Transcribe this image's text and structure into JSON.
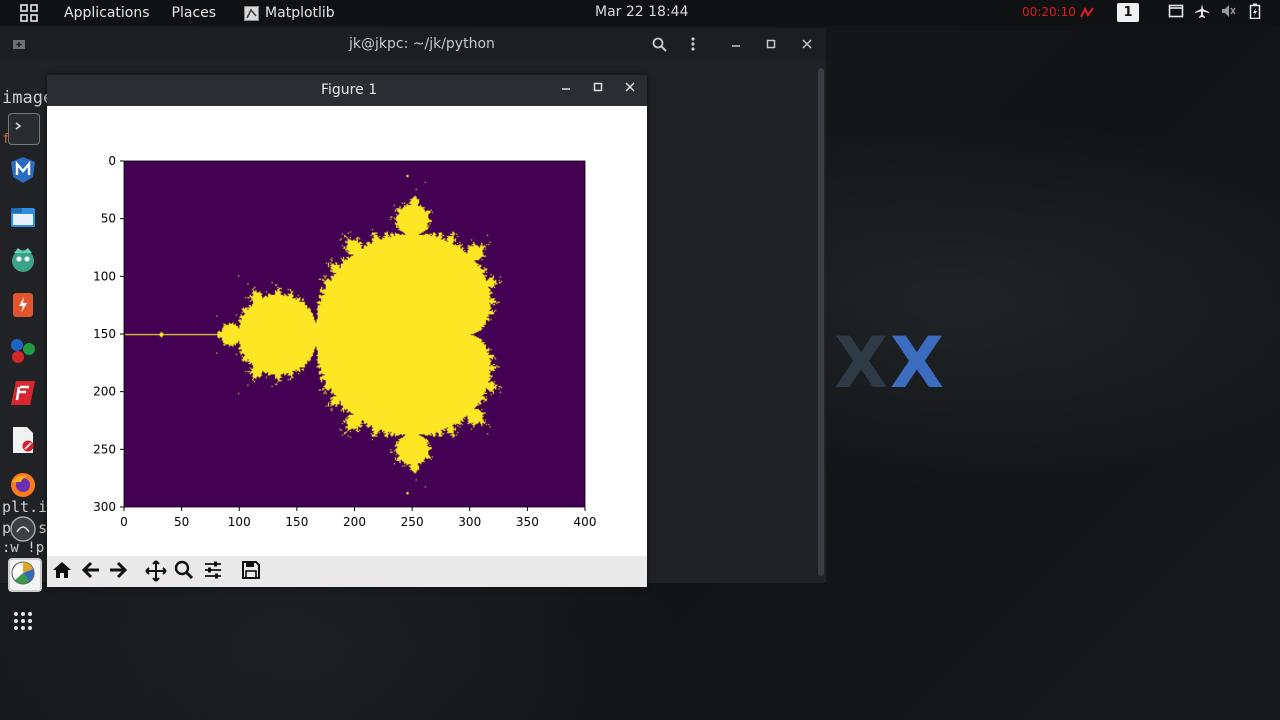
{
  "panel": {
    "menu_applications": "Applications",
    "menu_places": "Places",
    "active_app": "Matplotlib",
    "clock": "Mar 22  18:44",
    "timer": "00:20:10",
    "workspace": "1"
  },
  "terminal": {
    "title": "jk@jkpc: ~/jk/python",
    "lines": [
      "image",
      "fo",
      "plt.i",
      "plt.s",
      ":w !p"
    ]
  },
  "desktop": {
    "watermark": "LINUX",
    "watermark_x": "X"
  },
  "figure": {
    "title": "Figure 1",
    "toolbar": [
      "home-icon",
      "back-icon",
      "forward-icon",
      "pan-icon",
      "zoom-icon",
      "configure-icon",
      "save-icon"
    ]
  },
  "chart_data": {
    "type": "heatmap",
    "title": "",
    "xlabel": "",
    "ylabel": "",
    "xlim": [
      0,
      400
    ],
    "ylim": [
      300,
      0
    ],
    "xticks": [
      0,
      50,
      100,
      150,
      200,
      250,
      300,
      350,
      400
    ],
    "yticks": [
      0,
      50,
      100,
      150,
      200,
      250,
      300
    ],
    "colormap": [
      "#440154",
      "#fde725"
    ],
    "content": "Mandelbrot set membership"
  },
  "colors": {
    "panel_bg": "#0f1113",
    "terminal_bg": "#202225",
    "figure_titlebar": "#2a2d31",
    "toolbar_bg": "#e9e9e9",
    "timer_red": "#e21c1c"
  }
}
